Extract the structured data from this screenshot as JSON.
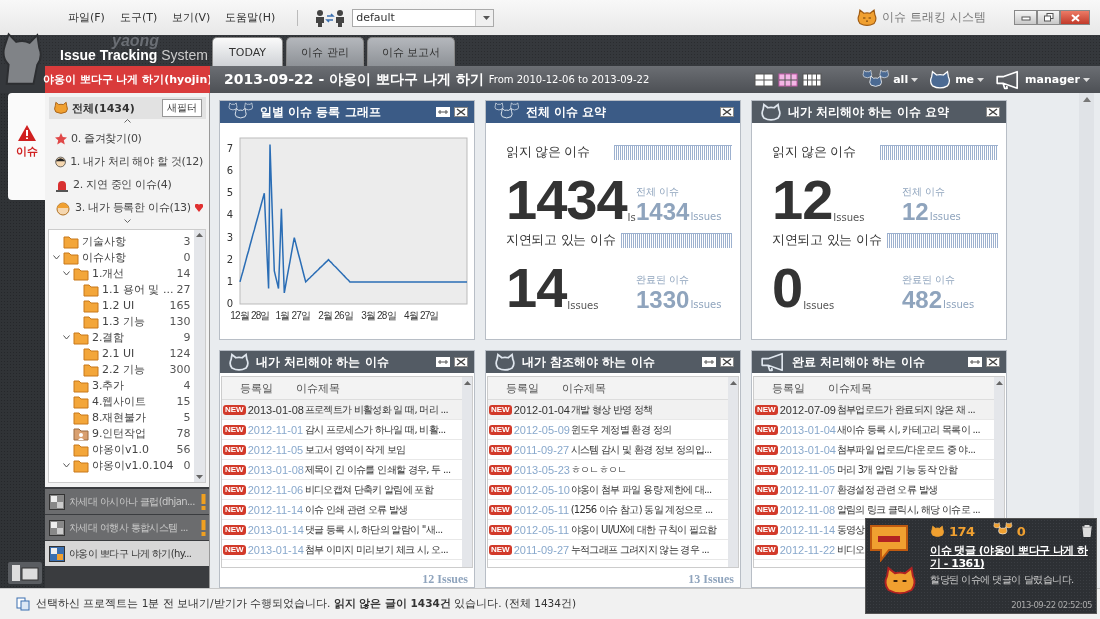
{
  "menu": {
    "items": [
      "파일(F)",
      "도구(T)",
      "보기(V)",
      "도움말(H)"
    ],
    "profile": "default"
  },
  "app_title": "이슈 트래킹 시스템",
  "logo": {
    "backdrop": "yaong",
    "brand": "Issue Tracking",
    "suffix": "System"
  },
  "tabs": [
    {
      "label": "TODAY",
      "selected": true
    },
    {
      "label": "이슈 관리",
      "selected": false
    },
    {
      "label": "이슈 보고서",
      "selected": false
    }
  ],
  "project_banner": "야옹이 뽀다구 나게 하기(hyojin)",
  "header": {
    "title": "2013-09-22 - 야옹이 뽀다구 나게 하기",
    "range": "From 2010-12-06 to 2013-09-22",
    "layouts": [
      {
        "kind": "grid-2",
        "selected": false
      },
      {
        "kind": "grid-3",
        "selected": true
      },
      {
        "kind": "grid-4",
        "selected": false
      }
    ],
    "filters": [
      {
        "kind": "group",
        "label": "all"
      },
      {
        "kind": "person",
        "label": "me"
      },
      {
        "kind": "megaphone",
        "label": "manager"
      }
    ]
  },
  "sidebar": {
    "tab": "이슈",
    "all": "전체(1434)",
    "new_filter": "새필터",
    "favorites": [
      {
        "kind": "star",
        "label": "0. 즐겨찾기(0)",
        "flagged": false
      },
      {
        "kind": "person",
        "label": "1. 내가 처리 해야 할 것(12)",
        "flagged": false
      },
      {
        "kind": "siren",
        "label": "2. 지연 중인 이슈(4)",
        "flagged": false
      },
      {
        "kind": "author",
        "label": "3. 내가 등록한 이슈(13)",
        "flagged": true
      }
    ],
    "tree": [
      {
        "kind": "folder",
        "label": "기술사항",
        "count": "3",
        "expanded": false
      },
      {
        "kind": "folder",
        "label": "이슈사항",
        "count": "0",
        "expanded": true,
        "children": [
          {
            "kind": "folder",
            "label": "1.개선",
            "count": "14",
            "expanded": true,
            "children": [
              {
                "kind": "folder",
                "label": "1.1 용어 및 ...",
                "count": "27",
                "expanded": false
              },
              {
                "kind": "folder",
                "label": "1.2 UI",
                "count": "165",
                "expanded": false
              },
              {
                "kind": "folder",
                "label": "1.3 기능",
                "count": "130",
                "expanded": false
              }
            ]
          },
          {
            "kind": "folder",
            "label": "2.결함",
            "count": "9",
            "expanded": true,
            "children": [
              {
                "kind": "folder",
                "label": "2.1 UI",
                "count": "124",
                "expanded": false
              },
              {
                "kind": "folder",
                "label": "2.2 기능",
                "count": "300",
                "expanded": false
              }
            ]
          },
          {
            "kind": "folder",
            "label": "3.추가",
            "count": "4",
            "expanded": false
          },
          {
            "kind": "folder",
            "label": "4.웹사이트",
            "count": "15",
            "expanded": false
          },
          {
            "kind": "folder",
            "label": "8.재현불가",
            "count": "5",
            "expanded": false
          },
          {
            "kind": "shared-folder",
            "label": "9.인턴작업",
            "count": "78",
            "expanded": false
          },
          {
            "kind": "folder",
            "label": "야옹이v1.0",
            "count": "56",
            "expanded": false
          },
          {
            "kind": "folder",
            "label": "야옹이v1.0.104",
            "count": "0",
            "expanded": true
          }
        ]
      }
    ],
    "projects": [
      {
        "label": "차세대 아시아나 클럽(dhjan...",
        "warning": true,
        "selected": false
      },
      {
        "label": "차세대 여행사 통합시스템 ...",
        "warning": true,
        "selected": false
      },
      {
        "label": "야옹이 뽀다구 나게 하기(hy...",
        "warning": false,
        "selected": true
      }
    ]
  },
  "panels": [
    {
      "kind": "chart",
      "title": "일별 이슈 등록 그래프",
      "highlighted": true,
      "resizable": true,
      "chart_data": {
        "type": "line",
        "categories": [
          null,
          null,
          null,
          null,
          null,
          null,
          null,
          "12월 28일",
          null,
          null,
          null,
          null,
          null,
          null,
          null,
          null,
          null,
          null,
          null,
          null,
          null,
          null,
          null,
          null,
          null,
          null,
          null,
          null,
          null,
          null,
          null,
          null,
          null,
          null,
          null,
          null,
          null,
          "1월 27일",
          null,
          null,
          null,
          null,
          null,
          null,
          null,
          null,
          null,
          null,
          null,
          null,
          null,
          null,
          null,
          null,
          null,
          null,
          null,
          null,
          null,
          null,
          null,
          null,
          null,
          null,
          null,
          null,
          null,
          "2월 26일",
          null,
          null,
          null,
          null,
          null,
          null,
          null,
          null,
          null,
          null,
          null,
          null,
          null,
          null,
          null,
          null,
          null,
          null,
          null,
          null,
          null,
          null,
          null,
          null,
          null,
          null,
          null,
          null,
          null,
          "3월 28일",
          null,
          null,
          null,
          null,
          null,
          null,
          null,
          null,
          null,
          null,
          null,
          null,
          null,
          null,
          null,
          null,
          null,
          null,
          null,
          null,
          null,
          null,
          null,
          null,
          null,
          null,
          null,
          null,
          null,
          "4월 27일",
          null,
          null,
          null,
          null,
          null,
          null,
          null,
          null,
          null,
          null,
          null,
          null,
          null,
          null,
          null,
          null,
          null,
          null,
          null,
          null,
          null,
          null,
          null,
          null,
          null,
          null,
          null,
          null,
          null,
          null,
          null,
          null
        ],
        "series": [
          {
            "color": "#2a6db5",
            "values": [
              1,
              1.24,
              1.47,
              1.71,
              1.94,
              2.18,
              2.41,
              2.65,
              2.88,
              3.12,
              3.35,
              3.59,
              3.82,
              4.06,
              4.29,
              4.53,
              4.76,
              5,
              3.57,
              2.13,
              0.7,
              7.2,
              5.3,
              3.4,
              1.5,
              1.23,
              0.97,
              0.7,
              2.5,
              4.3,
              2.4,
              0.5,
              0.86,
              1.21,
              1.57,
              1.93,
              2.29,
              2.64,
              3,
              2.75,
              2.5,
              2.25,
              2,
              1.75,
              1.5,
              1.25,
              1,
              1.06,
              1.13,
              1.19,
              1.25,
              1.31,
              1.38,
              1.44,
              1.5,
              1.56,
              1.63,
              1.69,
              1.75,
              1.81,
              1.88,
              1.94,
              2,
              1.93,
              1.87,
              1.8,
              1.73,
              1.67,
              1.6,
              1.53,
              1.47,
              1.4,
              1.33,
              1.27,
              1.2,
              1.13,
              1.07,
              1,
              1,
              1,
              1,
              1,
              1,
              1,
              1,
              1,
              1,
              1,
              1,
              1,
              1,
              1,
              1,
              1,
              1,
              1,
              1,
              1,
              1,
              1,
              1,
              1,
              1,
              1,
              1,
              1,
              1,
              1,
              1,
              1,
              1,
              1,
              1,
              1,
              1,
              1,
              1,
              1,
              1,
              1,
              1,
              1,
              1,
              1,
              1,
              1,
              1,
              1,
              1,
              1,
              1,
              1,
              1,
              1,
              1,
              1,
              1,
              1,
              1,
              1,
              1,
              1,
              1,
              1,
              1,
              1,
              1,
              1,
              1,
              1,
              1,
              1,
              1,
              1,
              1,
              1,
              1,
              1,
              1,
              1
            ]
          }
        ],
        "ylim": [
          0,
          7.5
        ],
        "yticks": [
          0,
          1,
          2,
          3,
          4,
          5,
          6,
          7
        ]
      }
    },
    {
      "kind": "summary",
      "title": "전체 이슈 요약",
      "highlighted": true,
      "resizable": false,
      "metrics": [
        {
          "label": "읽지 않은 이슈",
          "value": "1434",
          "unit": "Is",
          "total_label": "전체 이슈",
          "total": "1434",
          "total_unit": "Issues"
        },
        {
          "label": "지연되고 있는 이슈",
          "value": "14",
          "unit": "Issues",
          "total_label": "완료된 이슈",
          "total": "1330",
          "total_unit": "Issues"
        }
      ]
    },
    {
      "kind": "summary",
      "title": "내가 처리해야 하는 이슈 요약",
      "highlighted": false,
      "resizable": false,
      "metrics": [
        {
          "label": "읽지 않은 이슈",
          "value": "12",
          "unit": "Issues",
          "total_label": "전체 이슈",
          "total": "12",
          "total_unit": "Issues"
        },
        {
          "label": "지연되고 있는 이슈",
          "value": "0",
          "unit": "Issues",
          "total_label": "완료된 이슈",
          "total": "482",
          "total_unit": "Issues"
        }
      ]
    },
    {
      "kind": "list",
      "title": "내가 처리해야 하는 이슈",
      "highlighted": false,
      "resizable": true,
      "columns": [
        "등록일",
        "이슈제목"
      ],
      "footer": "12 Issues",
      "rows": [
        {
          "badge": "NEW",
          "date": "2013-01-08",
          "title": "프로젝트가 비활성화 일 때, 머리 ...",
          "selected": true
        },
        {
          "badge": "NEW",
          "date": "2012-11-01",
          "title": "감시 프로세스가 하나일 때, 비활...",
          "selected": false
        },
        {
          "badge": "NEW",
          "date": "2012-11-05",
          "title": "보고서 영역이 작게 보임",
          "selected": false
        },
        {
          "badge": "NEW",
          "date": "2013-01-08",
          "title": "제목이 긴 이슈를 인쇄할 경우, 두 ...",
          "selected": false
        },
        {
          "badge": "NEW",
          "date": "2012-11-06",
          "title": "비디오캡쳐 단축키 알림에 포함",
          "selected": false
        },
        {
          "badge": "NEW",
          "date": "2012-11-14",
          "title": "이슈 인쇄 관련 오류 발생",
          "selected": false
        },
        {
          "badge": "NEW",
          "date": "2013-01-14",
          "title": "댓글 등록 시, 하단의 알람이 \"새...",
          "selected": false
        },
        {
          "badge": "NEW",
          "date": "2013-01-14",
          "title": "첨부 이미지 미리보기 체크 시, 오...",
          "selected": false
        }
      ]
    },
    {
      "kind": "list",
      "title": "내가 참조해야 하는 이슈",
      "highlighted": false,
      "resizable": true,
      "columns": [
        "등록일",
        "이슈제목"
      ],
      "footer": "13 Issues",
      "rows": [
        {
          "badge": "NEW",
          "date": "2012-01-04",
          "title": "개발 형상 반영 정책",
          "selected": true
        },
        {
          "badge": "NEW",
          "date": "2012-05-09",
          "title": "윈도우 계정별 환경 정의",
          "selected": false
        },
        {
          "badge": "NEW",
          "date": "2011-09-27",
          "title": "시스템 감시 및 환경 정보 정의입...",
          "selected": false
        },
        {
          "badge": "NEW",
          "date": "2013-05-23",
          "title": "ㅎㅇㄴㅎㅇㄴ",
          "selected": false
        },
        {
          "badge": "NEW",
          "date": "2012-05-10",
          "title": "야옹이 첨부 파일 용량 제한에 대...",
          "selected": false
        },
        {
          "badge": "NEW",
          "date": "2012-05-11",
          "title": "(1256 이슈 참고) 동일 계정으로 ...",
          "selected": false
        },
        {
          "badge": "NEW",
          "date": "2012-05-11",
          "title": "야옹이 UI/UX에 대한 규칙이 필요함",
          "selected": false
        },
        {
          "badge": "NEW",
          "date": "2011-09-27",
          "title": "누적그래프 그려지지 않는 경우 ...",
          "selected": false
        }
      ]
    },
    {
      "kind": "list",
      "title": "완료 처리해야 하는 이슈",
      "highlighted": false,
      "resizable": true,
      "columns": [
        "등록일",
        "이슈제목"
      ],
      "rows": [
        {
          "badge": "NEW",
          "date": "2012-07-09",
          "title": "첨부업로드가 완료되지 않은 채 ...",
          "selected": true
        },
        {
          "badge": "NEW",
          "date": "2013-01-04",
          "title": "새이슈 등록 시, 카테고리 목록이 ...",
          "selected": false
        },
        {
          "badge": "NEW",
          "date": "2013-01-04",
          "title": "첨부파일 업로드/다운로드 중 야...",
          "selected": false
        },
        {
          "badge": "NEW",
          "date": "2012-11-05",
          "title": "머리 3개 알림 기능 동작 안함",
          "selected": false
        },
        {
          "badge": "NEW",
          "date": "2012-11-07",
          "title": "환경설정 관련 오류 발생",
          "selected": false
        },
        {
          "badge": "NEW",
          "date": "2012-11-08",
          "title": "알림의 링크 클릭시, 해당 이슈로 ...",
          "selected": false
        },
        {
          "badge": "NEW",
          "date": "2012-11-14",
          "title": "동영상",
          "selected": false
        },
        {
          "badge": "NEW",
          "date": "2012-11-22",
          "title": "비디오",
          "selected": false
        }
      ]
    }
  ],
  "status_bar": "선택하신 프로젝트는 1분 전 보내기/받기가 수행되었습니다. **읽지 않은 글이 1434건** 있습니다. (전체 1434건)",
  "notification": {
    "mine": "174",
    "group": "0",
    "link": "이슈 댓글 (야옹이 뽀다구 나게 하기 - 1361)",
    "message": "할당된 이슈에 댓글이 달렸습니다.",
    "time": "2013-09-22 02:52:05"
  }
}
